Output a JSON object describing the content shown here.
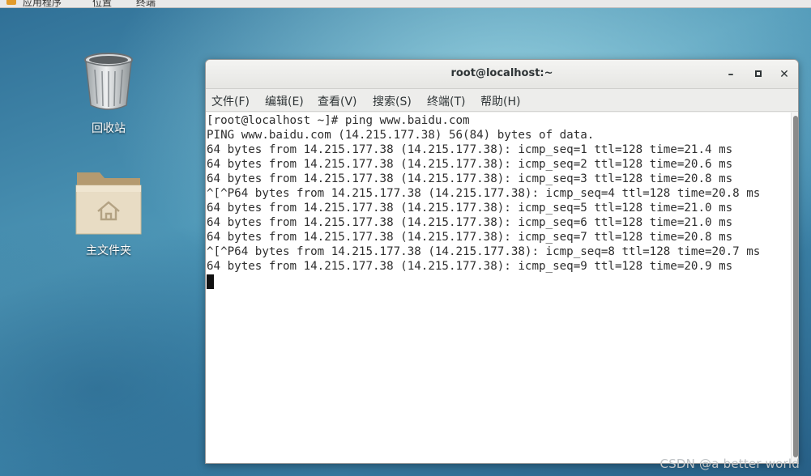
{
  "top_panel": {
    "applications_label": "应用程序",
    "places_label": "位置",
    "terminal_label": "终端"
  },
  "desktop": {
    "icons": [
      {
        "label": "回收站",
        "icon": "trash-icon"
      },
      {
        "label": "主文件夹",
        "icon": "home-folder-icon"
      }
    ]
  },
  "window": {
    "title": "root@localhost:~",
    "buttons": {
      "minimize": "minimize-icon",
      "maximize": "maximize-icon",
      "close": "close-icon"
    },
    "menu": [
      {
        "label": "文件(F)"
      },
      {
        "label": "编辑(E)"
      },
      {
        "label": "查看(V)"
      },
      {
        "label": "搜索(S)"
      },
      {
        "label": "终端(T)"
      },
      {
        "label": "帮助(H)"
      }
    ]
  },
  "terminal": {
    "lines": [
      "[root@localhost ~]# ping www.baidu.com",
      "PING www.baidu.com (14.215.177.38) 56(84) bytes of data.",
      "64 bytes from 14.215.177.38 (14.215.177.38): icmp_seq=1 ttl=128 time=21.4 ms",
      "64 bytes from 14.215.177.38 (14.215.177.38): icmp_seq=2 ttl=128 time=20.6 ms",
      "64 bytes from 14.215.177.38 (14.215.177.38): icmp_seq=3 ttl=128 time=20.8 ms",
      "^[^P64 bytes from 14.215.177.38 (14.215.177.38): icmp_seq=4 ttl=128 time=20.8 ms",
      "64 bytes from 14.215.177.38 (14.215.177.38): icmp_seq=5 ttl=128 time=21.0 ms",
      "64 bytes from 14.215.177.38 (14.215.177.38): icmp_seq=6 ttl=128 time=21.0 ms",
      "64 bytes from 14.215.177.38 (14.215.177.38): icmp_seq=7 ttl=128 time=20.8 ms",
      "^[^P64 bytes from 14.215.177.38 (14.215.177.38): icmp_seq=8 ttl=128 time=20.7 ms",
      "64 bytes from 14.215.177.38 (14.215.177.38): icmp_seq=9 ttl=128 time=20.9 ms"
    ]
  },
  "watermark": "CSDN @a better world"
}
